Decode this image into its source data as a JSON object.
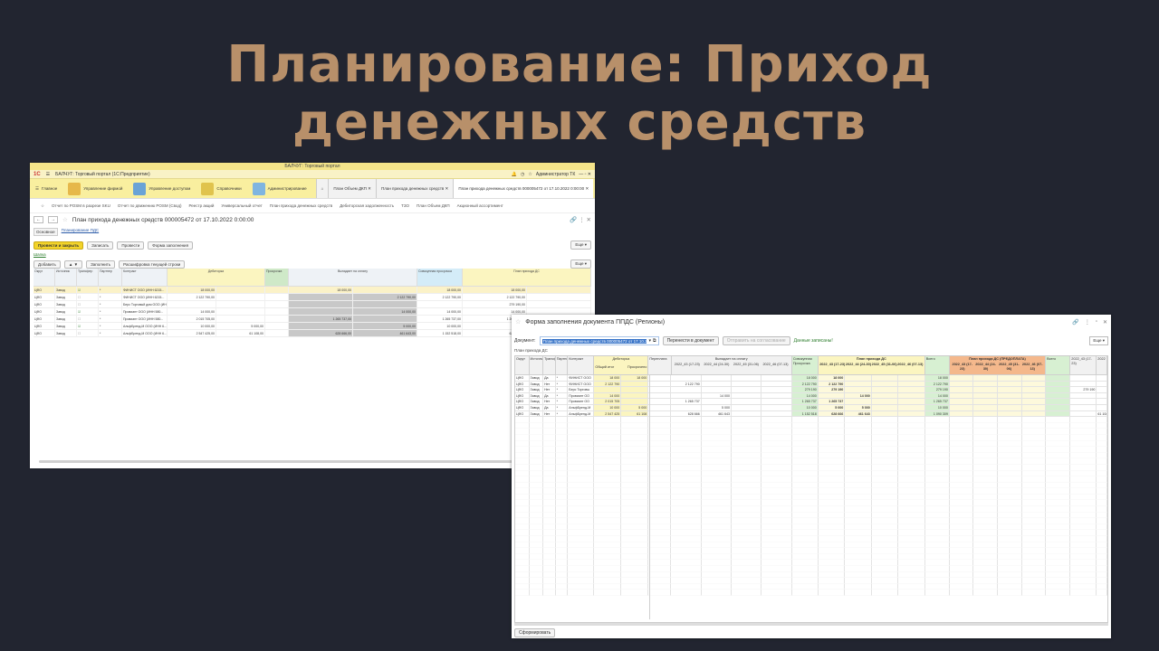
{
  "slide": {
    "title_line1": "Планирование: Приход",
    "title_line2": "денежных средств"
  },
  "shot1": {
    "window_title": "БАЛЧУГ: Торговый портал",
    "app_title": "БАЛЧУГ: Торговый портал (1С:Предприятие)",
    "user": "Администратор ТК",
    "sections": [
      "Главное",
      "Управление фирмой",
      "Управление доступом",
      "Справочники",
      "Администрирование"
    ],
    "section_colors": [
      "#e6b84a",
      "#6aa3d6",
      "#e0c34d",
      "#7fb5e0"
    ],
    "tabs": [
      "План Объем ДКП",
      "План прихода денежных средств",
      "План прихода денежных средств 000005472 от 17.10.2022 0:00:00"
    ],
    "panel_links": [
      "Отчет по POSM в разрезе SKU",
      "Отчет по движению POSM (Свод)",
      "Реестр акций",
      "Универсальный отчет",
      "План прихода денежных средств",
      "Дебиторская задолженность",
      "ТЗО",
      "План Объем ДКП",
      "Акционный ассортимент"
    ],
    "doc_title": "План прихода денежных средств 000005472 от 17.10.2022 0:00:00",
    "link_main": "Основное",
    "link_plan": "Планирование ПДС",
    "cmd": {
      "post_close": "Провести и закрыть",
      "write": "Записать",
      "post": "Провести",
      "fill_form": "Форма заполнения",
      "more": "Еще"
    },
    "shapka": "Шапка",
    "table_cmd": {
      "add": "Добавить",
      "fill": "Заполнить",
      "decode": "Расшифровка текущей строки",
      "more": "Еще"
    },
    "headers": [
      "Округ",
      "Источник",
      "Трансфер",
      "Партнер",
      "Контракт",
      "Дебиторка",
      "Просрочка",
      "Выпадает на оплату",
      "Совокупная просрочка",
      "План прихода ДС"
    ],
    "sub_headers": [
      "Общий итог",
      "в т.ч. просрочен. Внесли",
      "Просрочено",
      "2022_43 (17-23)",
      "2022_44 (24-30)",
      "2022_45 (31-06)",
      "2022_46 (07-13)"
    ],
    "rows": [
      {
        "okrug": "ЦФО",
        "src": "Завод",
        "chk": true,
        "p": "*",
        "k": "ФИНИСТ ООО (ИНН 6215...",
        "a": "18 000,00",
        "b": "",
        "c": "18 000,00",
        "d": "",
        "e": "18 000,00",
        "f": "18 000,00"
      },
      {
        "okrug": "ЦФО",
        "src": "Завод",
        "chk": false,
        "p": "*",
        "k": "ФИНИСТ ООО (ИНН 6215...",
        "a": "2 122 790,00",
        "b": "",
        "c": "",
        "d": "2 122 790,00",
        "e": "2 122 790,00",
        "f": "2 122 790,00"
      },
      {
        "okrug": "ЦФО",
        "src": "Завод",
        "chk": false,
        "p": "*",
        "k": "Берс Торговый дом ООО (ИН...",
        "a": "",
        "b": "",
        "c": "",
        "d": "",
        "e": "",
        "f": "279 190,00"
      },
      {
        "okrug": "ЦФО",
        "src": "Завод",
        "chk": true,
        "p": "*",
        "k": "Провиант ООО (ИНН 580...",
        "a": "14 000,00",
        "b": "",
        "c": "",
        "d": "14 000,00",
        "e": "14 000,00",
        "f": "14 000,00"
      },
      {
        "okrug": "ЦФО",
        "src": "Завод",
        "chk": false,
        "p": "*",
        "k": "Провиант ООО (ИНН 580...",
        "a": "2 015 705,00",
        "b": "",
        "c": "1 265 737,00",
        "d": "",
        "e": "1 265 737,00",
        "f": "1 265 737,00"
      },
      {
        "okrug": "ЦФО",
        "src": "Завод",
        "chk": true,
        "p": "*",
        "k": "АльфБренд-М ООО (ИНН 6...",
        "a": "10 000,00",
        "b": "5 000,00",
        "c": "",
        "d": "5 000,00",
        "e": "10 000,00",
        "f": "5 000,00"
      },
      {
        "okrug": "ЦФО",
        "src": "Завод",
        "chk": false,
        "p": "*",
        "k": "АльфБренд-М ООО (ИНН 6...",
        "a": "2 547 425,00",
        "b": "61 108,00",
        "c": "628 666,00",
        "d": "461 643,00",
        "e": "1 152 518,00",
        "f": "628 666,00"
      }
    ]
  },
  "shot2": {
    "title": "Форма заполнения документа ППДС (Регионы)",
    "doc_label": "Документ:",
    "doc_value": "План прихода денежных средств 000005472 от 17.10.2022",
    "btn_transfer": "Перенести в документ",
    "btn_approve": "Отправить на согласование",
    "saved": "Данные записаны!",
    "more": "Еще",
    "section_label": "План прихода ДС",
    "headers": {
      "okrug": "Округ",
      "src": "Источник",
      "trans": "Трансфер",
      "partner": "Партнер",
      "contract": "Контракт",
      "debt": "Дебиторка",
      "debt_total": "Общий итог",
      "debt_over": "Просрочено",
      "overpay": "Переплата",
      "due": "Выпадает на оплату",
      "cumul": "Совокупная Просрочка",
      "plan": "План прихода ДС",
      "total": "Всего",
      "plan_pre": "План прихода ДС (ПРЕДОПЛАТА)",
      "total2": "Всего",
      "weeks": [
        "2022_43 (17-23)",
        "2022_44 (24-30)",
        "2022_45 (31-06)",
        "2022_46 (07-13)"
      ],
      "weeks_short": [
        "2022_43 (17-23)",
        "2022_44",
        "2022_45",
        "2022_46"
      ],
      "extra": [
        "2022_43 (17-23)",
        "2022"
      ]
    },
    "rows": [
      {
        "o": "ЦФО",
        "s": "Завод",
        "t": "Да",
        "p": "*",
        "k": "ФИНИСТ ООО",
        "dt": "18 000",
        "dp": "18 000",
        "w1": "",
        "cu": "18 000",
        "p1": "18 000",
        "p2": "",
        "tot": "18 000",
        "x1": ""
      },
      {
        "o": "ЦФО",
        "s": "Завод",
        "t": "Нет",
        "p": "*",
        "k": "ФИНИСТ ООО",
        "dt": "2 122 790",
        "dp": "",
        "w1": "2 122 790",
        "cu": "2 122 790",
        "p1": "2 122 790",
        "p2": "",
        "tot": "2 122 790",
        "x1": ""
      },
      {
        "o": "ЦФО",
        "s": "Завод",
        "t": "Нет",
        "p": "*",
        "k": "Берс Торговы",
        "dt": "",
        "dp": "",
        "w1": "",
        "cu": "279 190",
        "p1": "279 190",
        "p2": "",
        "tot": "279 190",
        "x1": "279 190"
      },
      {
        "o": "ЦФО",
        "s": "Завод",
        "t": "Да",
        "p": "*",
        "k": "Провиант ОО",
        "dt": "14 000",
        "dp": "",
        "w2": "14 000",
        "cu": "14 000",
        "p1": "",
        "p2": "14 000",
        "tot": "14 000",
        "x1": ""
      },
      {
        "o": "ЦФО",
        "s": "Завод",
        "t": "Нет",
        "p": "*",
        "k": "Провиант ОО",
        "dt": "2 015 705",
        "dp": "",
        "w1": "1 265 737",
        "cu": "1 265 737",
        "p1": "1 265 737",
        "p2": "",
        "tot": "1 265 737",
        "x1": ""
      },
      {
        "o": "ЦФО",
        "s": "Завод",
        "t": "Да",
        "p": "*",
        "k": "АльфБренд-М",
        "dt": "10 000",
        "dp": "5 000",
        "w2": "5 000",
        "cu": "10 000",
        "p1": "5 000",
        "p2": "5 000",
        "tot": "10 000",
        "x1": ""
      },
      {
        "o": "ЦФО",
        "s": "Завод",
        "t": "Нет",
        "p": "*",
        "k": "АльфБренд-М",
        "dt": "2 547 425",
        "dp": "61 108",
        "w1": "628 666",
        "w2": "461 643",
        "cu": "1 152 518",
        "p1": "628 666",
        "p2": "461 643",
        "tot": "1 090 309",
        "x2": "61 108"
      }
    ],
    "footer_btn": "Сформировать"
  }
}
